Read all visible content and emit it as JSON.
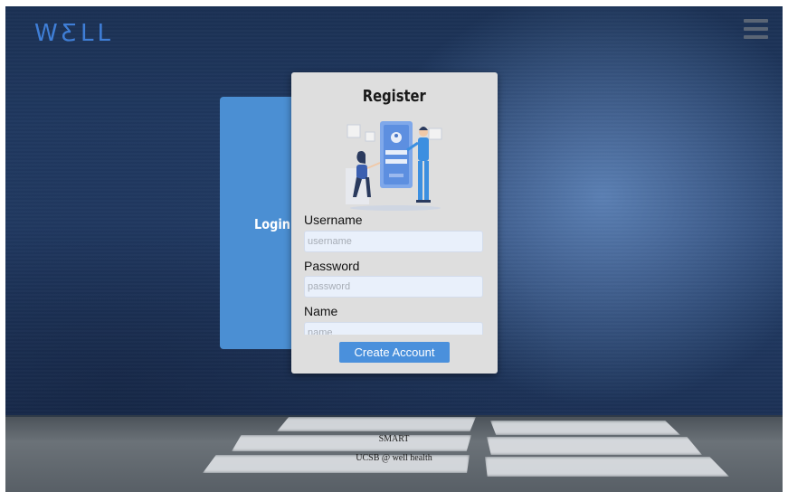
{
  "header": {
    "logo": "WƸLL",
    "menu_icon": "hamburger-menu-icon"
  },
  "login_panel": {
    "label": "Login"
  },
  "register_panel": {
    "title": "Register",
    "illustration": "registration-illustration",
    "fields": [
      {
        "label": "Username",
        "placeholder": "username"
      },
      {
        "label": "Password",
        "placeholder": "password"
      },
      {
        "label": "Name",
        "placeholder": "name"
      }
    ],
    "submit_label": "Create Account"
  },
  "footer": {
    "line1": "SMART",
    "line2": "UCSB @ well health"
  },
  "colors": {
    "accent": "#4a90dc",
    "login_panel": "#4b8fd3",
    "logo": "#3f7ed6",
    "card": "#dedede"
  }
}
